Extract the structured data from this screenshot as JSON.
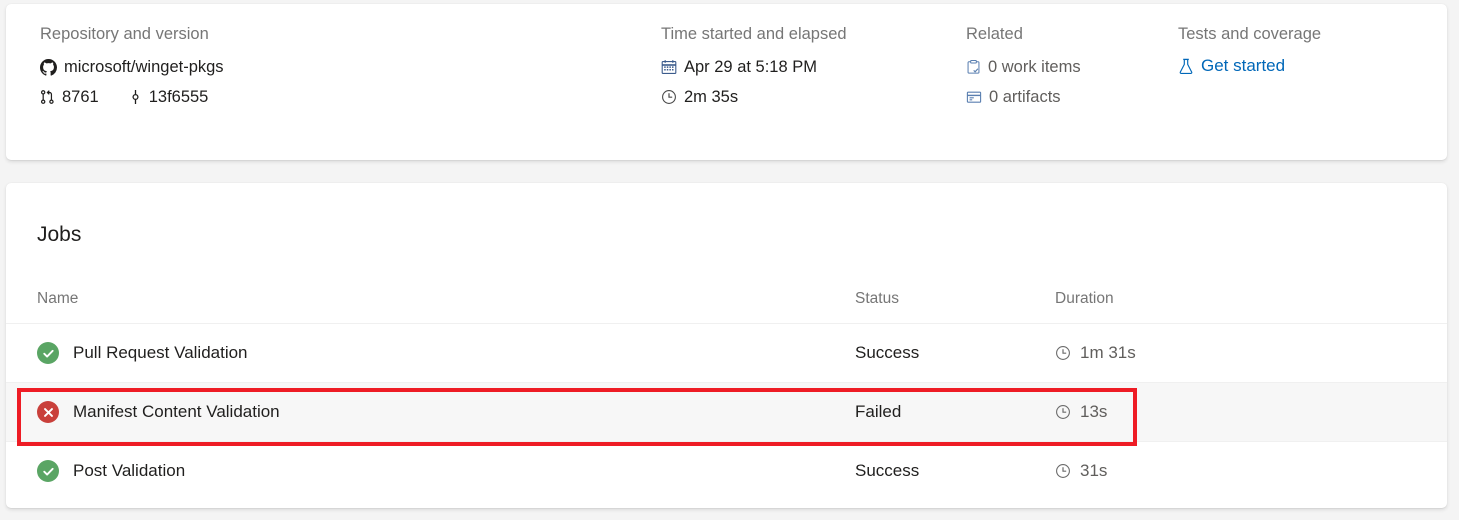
{
  "summary": {
    "columns": [
      {
        "heading": "Repository and version",
        "repo_icon": "github-icon",
        "repo_name": "microsoft/winget-pkgs",
        "pr_icon": "pull-request-icon",
        "pr_number": "8761",
        "commit_icon": "commit-icon",
        "commit_sha": "13f6555"
      },
      {
        "heading": "Time started and elapsed",
        "calendar_icon": "calendar-icon",
        "started": "Apr 29 at 5:18 PM",
        "clock_icon": "clock-icon",
        "elapsed": "2m 35s"
      },
      {
        "heading": "Related",
        "work_items_icon": "clipboard-check-icon",
        "work_items": "0 work items",
        "artifacts_icon": "artifact-box-icon",
        "artifacts": "0 artifacts"
      },
      {
        "heading": "Tests and coverage",
        "flask_icon": "flask-icon",
        "get_started_label": "Get started"
      }
    ]
  },
  "jobs": {
    "title": "Jobs",
    "headers": {
      "name": "Name",
      "status": "Status",
      "duration": "Duration"
    },
    "rows": [
      {
        "icon": "success-check-icon",
        "state": "ok",
        "name": "Pull Request Validation",
        "status": "Success",
        "duration_icon": "clock-icon",
        "duration": "1m 31s",
        "highlighted": false
      },
      {
        "icon": "failed-x-icon",
        "state": "fail",
        "name": "Manifest Content Validation",
        "status": "Failed",
        "duration_icon": "clock-icon",
        "duration": "13s",
        "highlighted": true
      },
      {
        "icon": "success-check-icon",
        "state": "ok",
        "name": "Post Validation",
        "status": "Success",
        "duration_icon": "clock-icon",
        "duration": "31s",
        "highlighted": false
      }
    ]
  },
  "annotation": {
    "name": "red-highlight-rectangle",
    "color": "#ee1c25"
  },
  "colors": {
    "success": "#5aa564",
    "failure": "#c9403b",
    "link": "#0067b8",
    "muted_text": "#767676",
    "body_text": "#201f1e",
    "page_background": "#f4f4f4",
    "card_background": "#ffffff",
    "highlight_row_background": "#f7f7f7"
  }
}
